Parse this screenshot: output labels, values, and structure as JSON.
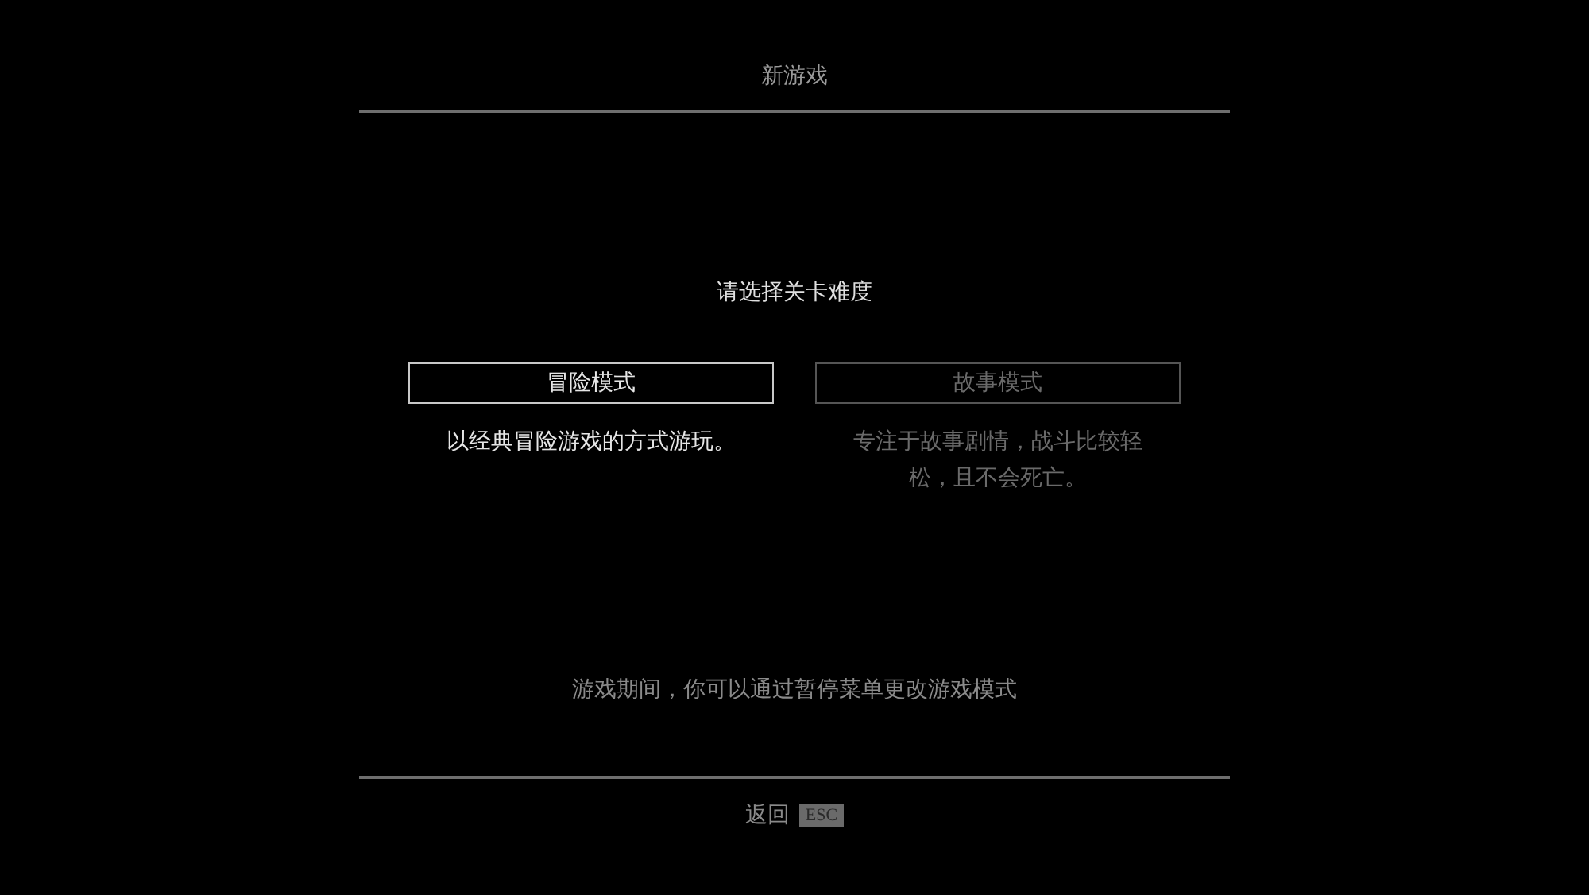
{
  "title": "新游戏",
  "prompt": "请选择关卡难度",
  "modes": [
    {
      "label": "冒险模式",
      "description": "以经典冒险游戏的方式游玩。",
      "selected": true
    },
    {
      "label": "故事模式",
      "description": "专注于故事剧情，战斗比较轻松，且不会死亡。",
      "selected": false
    }
  ],
  "hint": "游戏期间，你可以通过暂停菜单更改游戏模式",
  "footer": {
    "label": "返回",
    "key": "ESC"
  }
}
